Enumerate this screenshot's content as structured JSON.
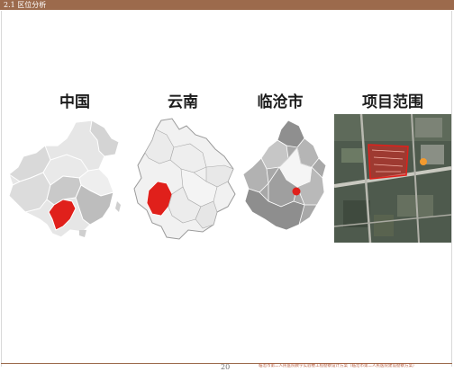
{
  "header": {
    "section": "2.1 区位分析"
  },
  "maps": [
    {
      "title": "中国"
    },
    {
      "title": "云南"
    },
    {
      "title": "临沧市"
    },
    {
      "title": "项目范围"
    }
  ],
  "footer": {
    "page": "20",
    "caption": "临沧市第二人民医院教学实验楼工程勘察设计方案（临沧市第二人民医院建设勘察方案）"
  },
  "colors": {
    "header_bar": "#9c6a4c",
    "highlight": "#e0201b",
    "project_marker": "#f39a2e"
  }
}
